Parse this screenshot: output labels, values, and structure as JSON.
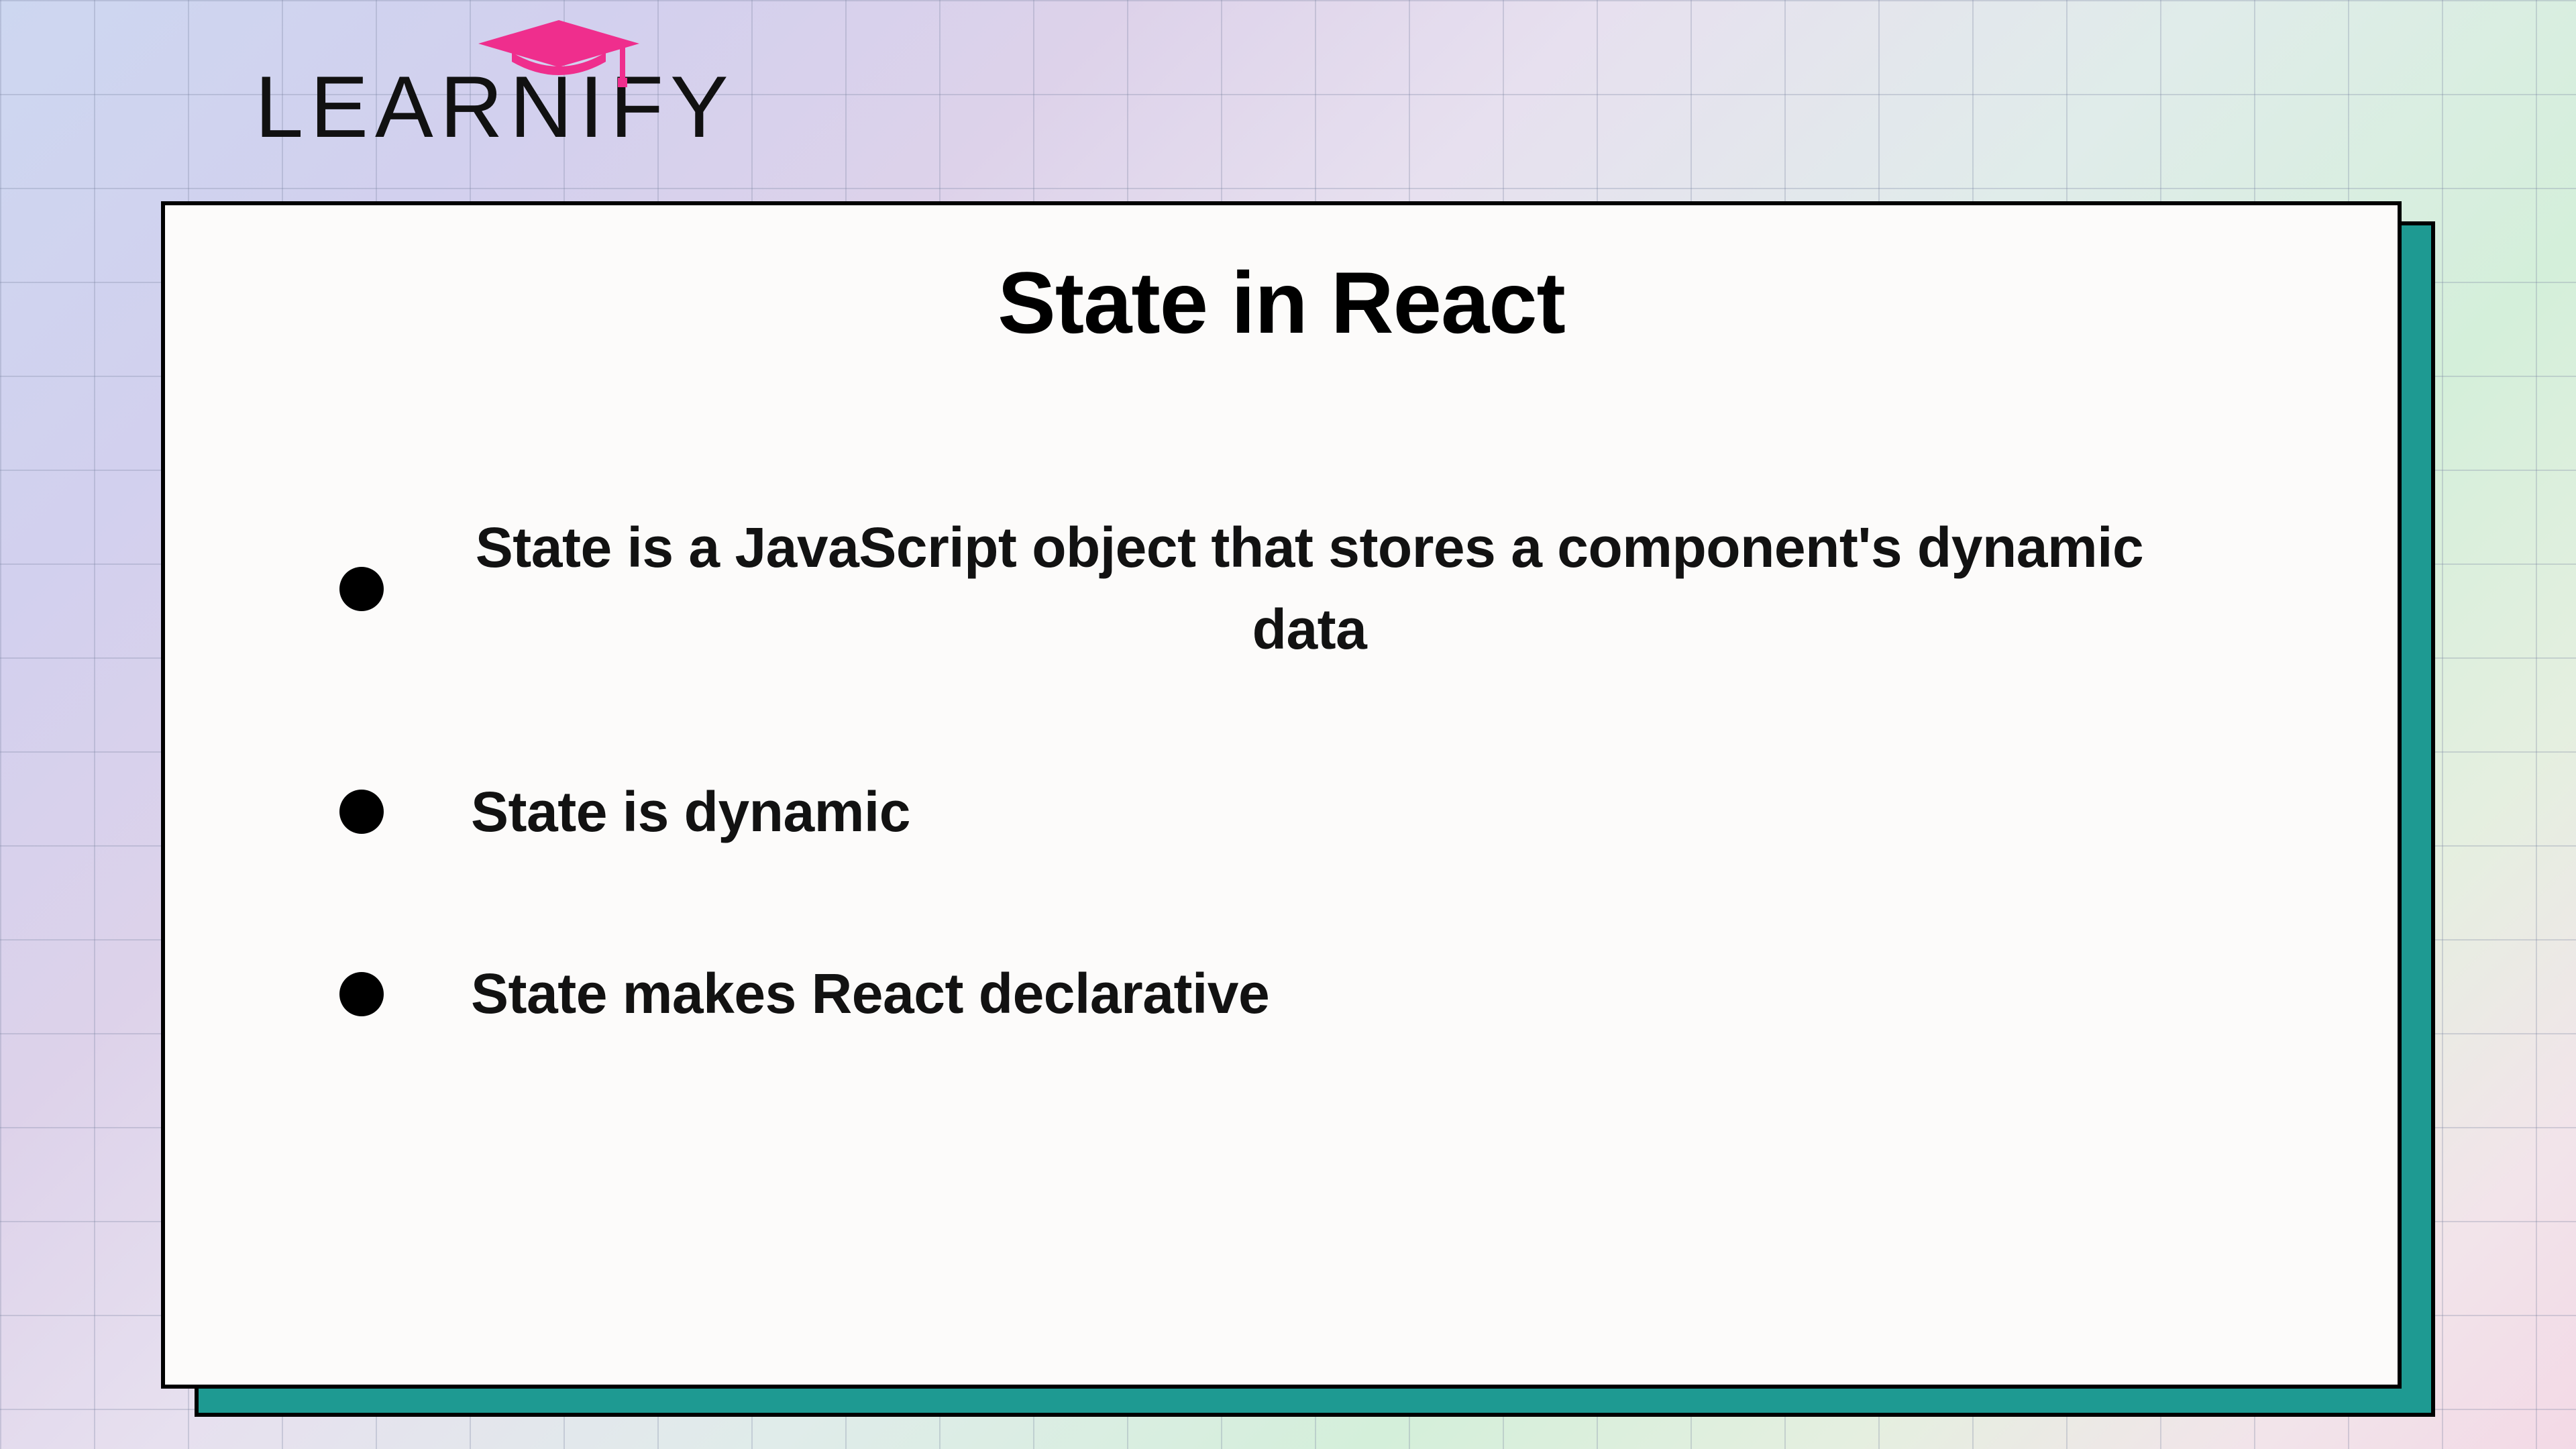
{
  "brand": {
    "name": "LEARNIFY",
    "accent_color": "#ef2e8d"
  },
  "slide": {
    "title": "State in React",
    "bullets": [
      "State is a JavaScript object that stores a component's dynamic data",
      "State is dynamic",
      "State makes React declarative"
    ]
  },
  "style": {
    "card_bg": "#fcfbfa",
    "card_shadow": "#1e9a92",
    "border": "#000000"
  }
}
